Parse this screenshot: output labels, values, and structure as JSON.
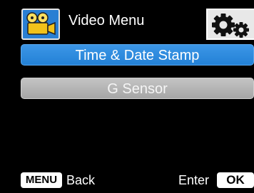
{
  "header": {
    "icon": "video-camera-icon",
    "title": "Video Menu",
    "settings_icon": "gears-icon"
  },
  "menu": {
    "items": [
      {
        "label": "Time & Date Stamp",
        "selected": true
      },
      {
        "label": "G Sensor",
        "selected": false
      }
    ]
  },
  "footer": {
    "menu_key": "MENU",
    "menu_action": "Back",
    "enter_action": "Enter",
    "ok_key": "OK"
  },
  "colors": {
    "background": "#000000",
    "selected_item": "#2a87da",
    "unselected_item": "#b3b3b3",
    "icon_tab": "#2a7fd3"
  }
}
